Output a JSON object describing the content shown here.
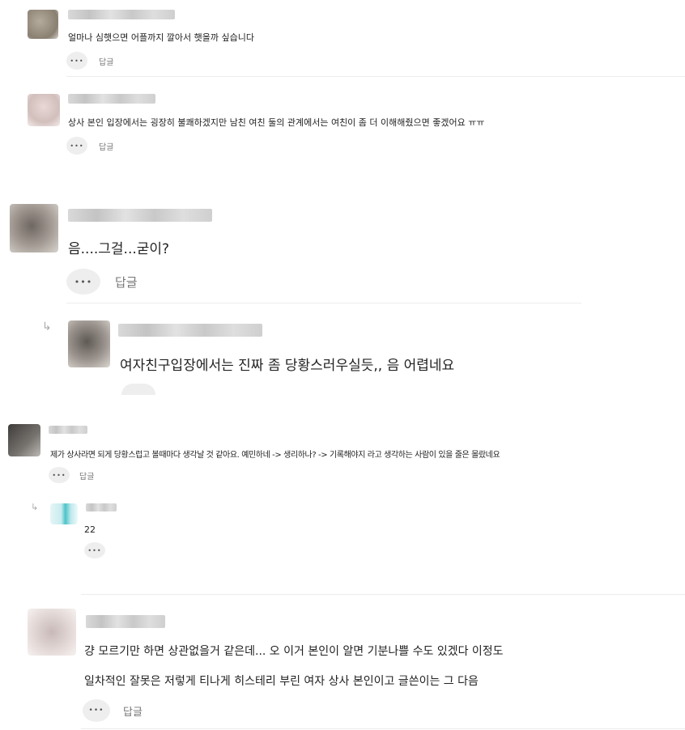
{
  "reply_label": "답글",
  "more_label": "•••",
  "reply_arrow": "↳",
  "comments": [
    {
      "text": "얼마나 심햇으면 어플까지 깔아서 햇을까 싶습니다"
    },
    {
      "text": "상사 본인 입장에서는 굉장히 불쾌하겠지만 남친 여친 둘의 관계에서는 여친이 좀 더 이해해줬으면 좋겠어요 ㅠㅠ"
    },
    {
      "text": "음....그걸...굳이?"
    },
    {
      "text": "여자친구입장에서는 진짜 좀 당황스러우실듯,, 음 어렵네요"
    },
    {
      "text": "제가 상사라면 되게 당황스럽고 볼때마다 생각날 것 같아요. 예민하네 -> 생리하나? -> 기록해야지 라고 생각하는 사람이 있을 줄은 몰랐네요"
    },
    {
      "text": "22"
    },
    {
      "text_line1": "걍 모르기만 하면 상관없을거 같은데... 오 이거 본인이 알면 기분나쁠 수도 있겠다 이정도",
      "text_line2": "일차적인 잘못은 저렇게 티나게 히스테리 부린 여자 상사 본인이고 글쓴이는 그 다음"
    }
  ]
}
